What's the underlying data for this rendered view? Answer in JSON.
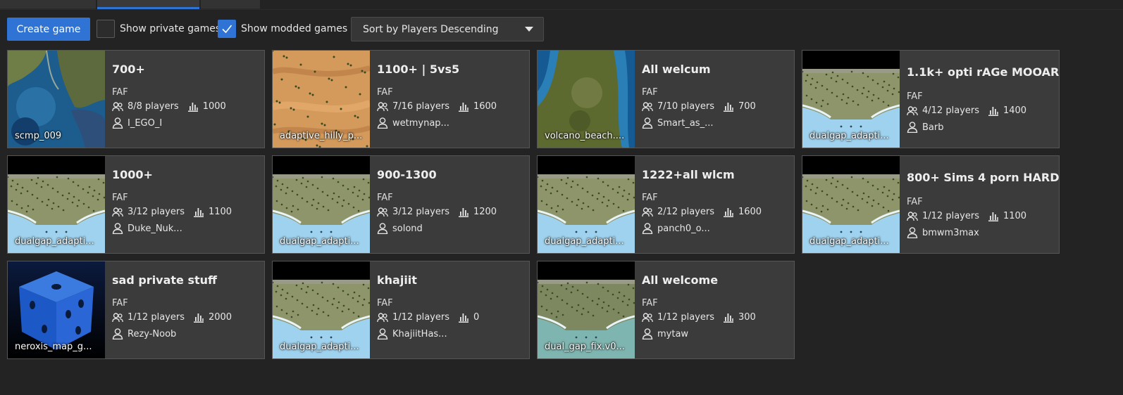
{
  "toolbar": {
    "create_label": "Create game",
    "show_private_label": "Show private games",
    "show_private_checked": false,
    "show_modded_label": "Show modded games",
    "show_modded_checked": true,
    "sort_value": "Sort by Players Descending"
  },
  "games": [
    {
      "title": "700+",
      "mod": "FAF",
      "players": "8/8 players",
      "rating": "1000",
      "host": "I_EGO_I",
      "map": "scmp_009",
      "thumb": "ocean"
    },
    {
      "title": "1100+ | 5vs5",
      "mod": "FAF",
      "players": "7/16 players",
      "rating": "1600",
      "host": "wetmynap...",
      "map": "adaptive_hilly_p...",
      "thumb": "desert"
    },
    {
      "title": "All welcum",
      "mod": "FAF",
      "players": "7/10 players",
      "rating": "700",
      "host": "Smart_as_...",
      "map": "volcano_beach....",
      "thumb": "volcano"
    },
    {
      "title": "1.1k+ opti rAGe MOOAR",
      "mod": "FAF",
      "players": "4/12 players",
      "rating": "1400",
      "host": "Barb",
      "map": "dualgap_adapti...",
      "thumb": "dualgap"
    },
    {
      "title": "1000+",
      "mod": "FAF",
      "players": "3/12 players",
      "rating": "1100",
      "host": "Duke_Nuk...",
      "map": "dualgap_adapti...",
      "thumb": "dualgap"
    },
    {
      "title": "900-1300",
      "mod": "FAF",
      "players": "3/12 players",
      "rating": "1200",
      "host": "solond",
      "map": "dualgap_adapti...",
      "thumb": "dualgap"
    },
    {
      "title": "1222+all wlcm",
      "mod": "FAF",
      "players": "2/12 players",
      "rating": "1600",
      "host": "panch0_o...",
      "map": "dualgap_adapti...",
      "thumb": "dualgap"
    },
    {
      "title": "800+ Sims 4 porn HARD",
      "mod": "FAF",
      "players": "1/12 players",
      "rating": "1100",
      "host": "bmwm3max",
      "map": "dualgap_adapti...",
      "thumb": "dualgap"
    },
    {
      "title": "sad private stuff",
      "mod": "FAF",
      "players": "1/12 players",
      "rating": "2000",
      "host": "Rezy-Noob",
      "map": "neroxis_map_g...",
      "thumb": "dice"
    },
    {
      "title": "khajiit",
      "mod": "FAF",
      "players": "1/12 players",
      "rating": "0",
      "host": "KhajiitHas...",
      "map": "dualgap_adapti...",
      "thumb": "dualgap"
    },
    {
      "title": "All welcome",
      "mod": "FAF",
      "players": "1/12 players",
      "rating": "300",
      "host": "mytaw",
      "map": "dual_gap_fix.v0...",
      "thumb": "dualgapfix"
    }
  ],
  "colors": {
    "accent": "#2f74d4",
    "card_bg": "#3b3b3b",
    "page_bg": "#232323"
  }
}
